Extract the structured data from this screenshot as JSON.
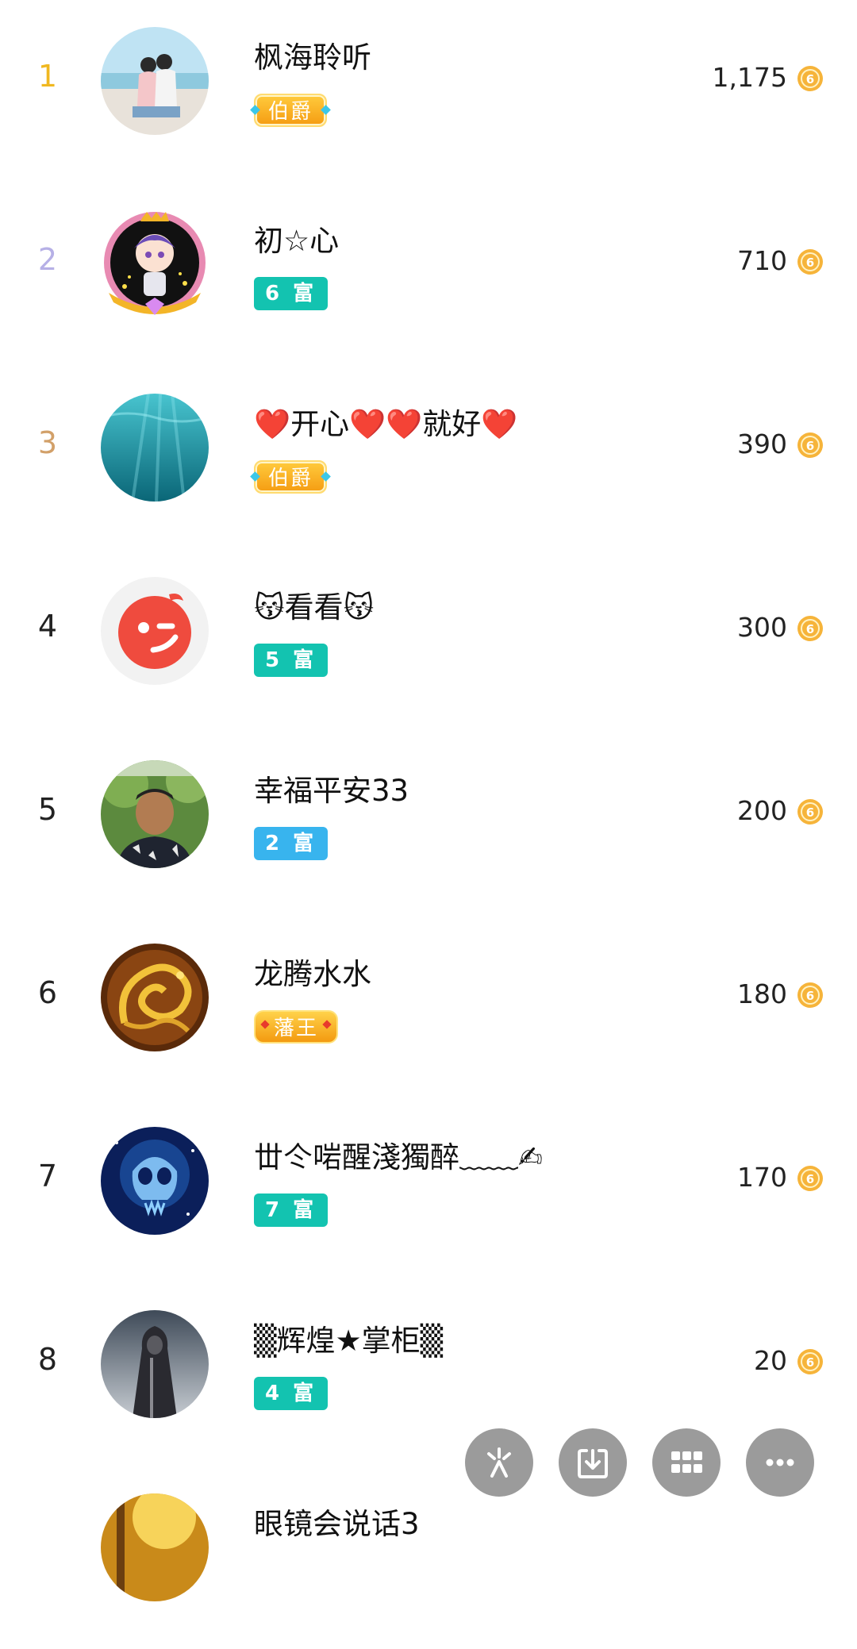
{
  "ranking": [
    {
      "rank": "1",
      "rank_color": "#f0b820",
      "name": "枫海聆听",
      "badge": "伯爵",
      "badge_type": "noble",
      "score": "1,175",
      "avatar": "couple-beach"
    },
    {
      "rank": "2",
      "rank_color": "#b6b0e6",
      "name": "初☆心",
      "badge": "6 富",
      "badge_type": "fu",
      "score": "710",
      "avatar": "cartoon-boy-frame"
    },
    {
      "rank": "3",
      "rank_color": "#d2a069",
      "name": "❤️开心❤️❤️就好❤️",
      "badge": "伯爵",
      "badge_type": "noble",
      "score": "390",
      "avatar": "underwater"
    },
    {
      "rank": "4",
      "rank_color": "#222222",
      "name": "😽看看😽",
      "badge": "5 富",
      "badge_type": "fu",
      "score": "300",
      "avatar": "wink-logo"
    },
    {
      "rank": "5",
      "rank_color": "#222222",
      "name": "幸福平安33",
      "badge": "2 富",
      "badge_type": "fu-blue",
      "score": "200",
      "avatar": "man-portrait"
    },
    {
      "rank": "6",
      "rank_color": "#222222",
      "name": "龙腾水水",
      "badge": "藩王",
      "badge_type": "king",
      "score": "180",
      "avatar": "golden-dragon"
    },
    {
      "rank": "7",
      "rank_color": "#222222",
      "name": "丗仒啱醒淺獨醉﹏﹏✍",
      "badge": "7 富",
      "badge_type": "fu",
      "score": "170",
      "avatar": "blue-skull"
    },
    {
      "rank": "8",
      "rank_color": "#222222",
      "name": "▒辉煌★掌柜▒",
      "badge": "4 富",
      "badge_type": "fu",
      "score": "20",
      "avatar": "hooded-figure"
    },
    {
      "rank": "",
      "rank_color": "#222222",
      "name": "眼镜会说话3",
      "badge": "",
      "badge_type": "",
      "score": "",
      "avatar": "golden-autumn"
    }
  ],
  "fab_buttons": [
    {
      "icon": "sparkle-icon"
    },
    {
      "icon": "download-icon"
    },
    {
      "icon": "grid-icon"
    },
    {
      "icon": "more-icon"
    }
  ],
  "colors": {
    "fu": "#13c3b0",
    "fu_blue": "#38b4ee",
    "coin": "#f6b43a",
    "fab": "#9b9b9b"
  }
}
